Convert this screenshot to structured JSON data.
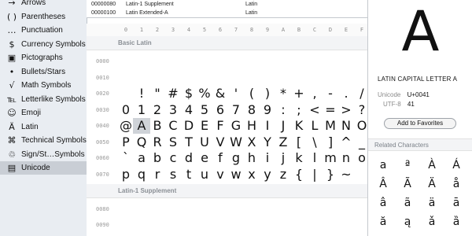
{
  "sidebar": {
    "items": [
      {
        "icon": "arrow-icon",
        "glyph": "→",
        "label": "Arrows"
      },
      {
        "icon": "parentheses-icon",
        "glyph": "( )",
        "label": "Parentheses"
      },
      {
        "icon": "punctuation-icon",
        "glyph": "…",
        "label": "Punctuation"
      },
      {
        "icon": "currency-icon",
        "glyph": "$",
        "label": "Currency Symbols"
      },
      {
        "icon": "pictograph-icon",
        "glyph": "▣",
        "label": "Pictographs"
      },
      {
        "icon": "bullet-icon",
        "glyph": "•",
        "label": "Bullets/Stars"
      },
      {
        "icon": "math-icon",
        "glyph": "√",
        "label": "Math Symbols"
      },
      {
        "icon": "letterlike-icon",
        "glyph": "℡",
        "label": "Letterlike Symbols"
      },
      {
        "icon": "emoji-icon",
        "glyph": "☺",
        "label": "Emoji"
      },
      {
        "icon": "latin-icon",
        "glyph": "Ä",
        "label": "Latin"
      },
      {
        "icon": "technical-icon",
        "glyph": "⌘",
        "label": "Technical Symbols"
      },
      {
        "icon": "signstandard-icon",
        "glyph": "♲",
        "label": "Sign/St…Symbols"
      },
      {
        "icon": "unicode-icon",
        "glyph": "▤",
        "label": "Unicode",
        "selected": true
      }
    ]
  },
  "ranges": [
    {
      "code": "00000080",
      "name": "Latin-1 Supplement",
      "script": "Latin"
    },
    {
      "code": "00000100",
      "name": "Latin Extended-A",
      "script": "Latin"
    }
  ],
  "columns": [
    "0",
    "1",
    "2",
    "3",
    "4",
    "5",
    "6",
    "7",
    "8",
    "9",
    "A",
    "B",
    "C",
    "D",
    "E",
    "F"
  ],
  "sections": {
    "basic": "Basic Latin",
    "supplement": "Latin-1 Supplement"
  },
  "rows": [
    {
      "label": "0000",
      "chars": []
    },
    {
      "label": "0010",
      "chars": []
    },
    {
      "label": "0020",
      "chars": [
        " ",
        "!",
        "\"",
        "#",
        "$",
        "%",
        "&",
        "'",
        "(",
        ")",
        "*",
        "+",
        ",",
        "-",
        ".",
        "/"
      ]
    },
    {
      "label": "0030",
      "chars": [
        "0",
        "1",
        "2",
        "3",
        "4",
        "5",
        "6",
        "7",
        "8",
        "9",
        ":",
        ";",
        "<",
        "=",
        ">",
        "?"
      ]
    },
    {
      "label": "0040",
      "chars": [
        "@",
        "A",
        "B",
        "C",
        "D",
        "E",
        "F",
        "G",
        "H",
        "I",
        "J",
        "K",
        "L",
        "M",
        "N",
        "O"
      ]
    },
    {
      "label": "0050",
      "chars": [
        "P",
        "Q",
        "R",
        "S",
        "T",
        "U",
        "V",
        "W",
        "X",
        "Y",
        "Z",
        "[",
        "\\",
        "]",
        "^",
        "_"
      ]
    },
    {
      "label": "0060",
      "chars": [
        "`",
        "a",
        "b",
        "c",
        "d",
        "e",
        "f",
        "g",
        "h",
        "i",
        "j",
        "k",
        "l",
        "m",
        "n",
        "o"
      ]
    },
    {
      "label": "0070",
      "chars": [
        "p",
        "q",
        "r",
        "s",
        "t",
        "u",
        "v",
        "w",
        "x",
        "y",
        "z",
        "{",
        "|",
        "}",
        "~",
        ""
      ]
    }
  ],
  "supplement_rows": [
    {
      "label": "0080"
    },
    {
      "label": "0090"
    }
  ],
  "selected_char": {
    "row": 4,
    "col": 1
  },
  "detail": {
    "glyph": "A",
    "name": "LATIN CAPITAL LETTER A",
    "unicode_label": "Unicode",
    "unicode_value": "U+0041",
    "utf8_label": "UTF-8",
    "utf8_value": "41",
    "favorites_button": "Add to Favorites",
    "related_title": "Related Characters",
    "related": [
      "a",
      "ª",
      "À",
      "Á",
      "Â",
      "Ã",
      "Ä",
      "å",
      "â",
      "ã",
      "ä",
      "ā",
      "ă",
      "ą",
      "ǎ",
      "ȁ"
    ]
  }
}
